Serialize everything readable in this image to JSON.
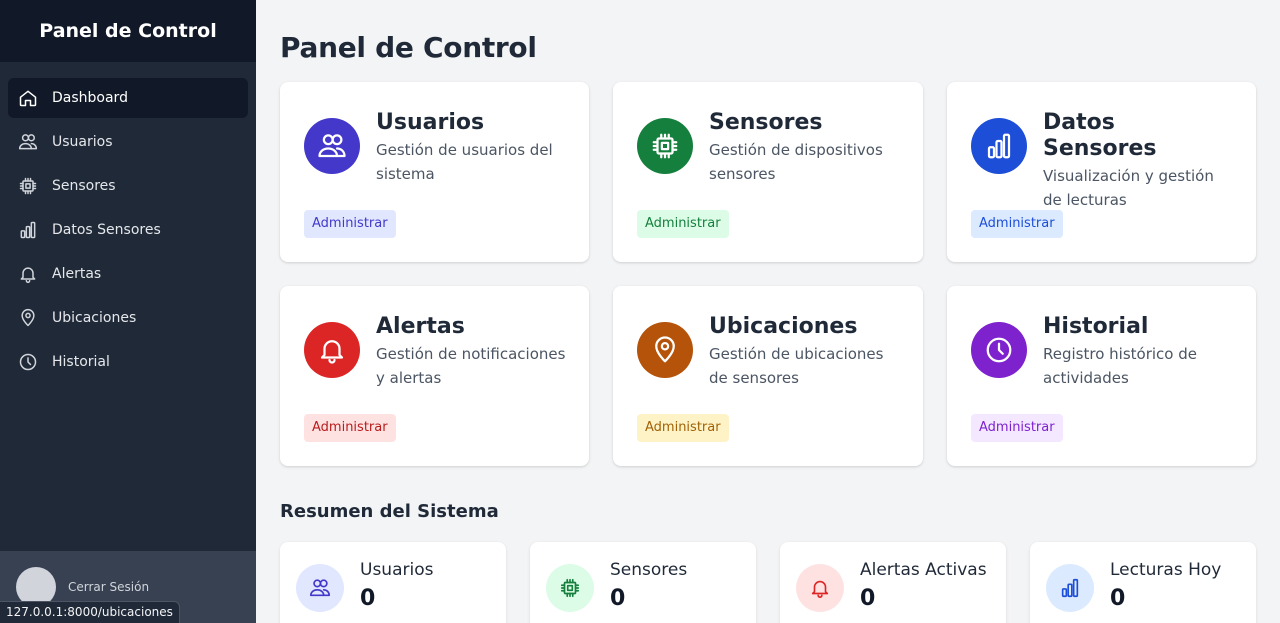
{
  "sidebar": {
    "title": "Panel de Control",
    "items": [
      {
        "label": "Dashboard",
        "icon": "home-icon"
      },
      {
        "label": "Usuarios",
        "icon": "users-icon"
      },
      {
        "label": "Sensores",
        "icon": "chip-icon"
      },
      {
        "label": "Datos Sensores",
        "icon": "bar-chart-icon"
      },
      {
        "label": "Alertas",
        "icon": "bell-icon"
      },
      {
        "label": "Ubicaciones",
        "icon": "map-pin-icon"
      },
      {
        "label": "Historial",
        "icon": "clock-icon"
      }
    ],
    "logout_label": "Cerrar Sesión"
  },
  "status_bar": {
    "url": "127.0.0.1:8000/ubicaciones"
  },
  "main": {
    "title": "Panel de Control",
    "cards": [
      {
        "title": "Usuarios",
        "description": "Gestión de usuarios del sistema",
        "action": "Administrar",
        "icon": "users-icon",
        "color": "#4338ca",
        "badge_bg": "#e0e7ff",
        "badge_fg": "#4338ca"
      },
      {
        "title": "Sensores",
        "description": "Gestión de dispositivos sensores",
        "action": "Administrar",
        "icon": "chip-icon",
        "color": "#15803d",
        "badge_bg": "#dcfce7",
        "badge_fg": "#15803d"
      },
      {
        "title": "Datos Sensores",
        "description": "Visualización y gestión de lecturas",
        "action": "Administrar",
        "icon": "bar-chart-icon",
        "color": "#1d4ed8",
        "badge_bg": "#dbeafe",
        "badge_fg": "#1d4ed8"
      },
      {
        "title": "Alertas",
        "description": "Gestión de notificaciones y alertas",
        "action": "Administrar",
        "icon": "bell-icon",
        "color": "#dc2626",
        "badge_bg": "#fee2e2",
        "badge_fg": "#b91c1c"
      },
      {
        "title": "Ubicaciones",
        "description": "Gestión de ubicaciones de sensores",
        "action": "Administrar",
        "icon": "map-pin-icon",
        "color": "#b45309",
        "badge_bg": "#fef3c7",
        "badge_fg": "#a16207"
      },
      {
        "title": "Historial",
        "description": "Registro histórico de actividades",
        "action": "Administrar",
        "icon": "clock-icon",
        "color": "#7e22ce",
        "badge_bg": "#f3e8ff",
        "badge_fg": "#7e22ce"
      }
    ],
    "summary_title": "Resumen del Sistema",
    "stats": [
      {
        "label": "Usuarios",
        "value": "0",
        "icon": "users-icon",
        "fg": "#4338ca",
        "bg": "#e0e7ff"
      },
      {
        "label": "Sensores",
        "value": "0",
        "icon": "chip-icon",
        "fg": "#15803d",
        "bg": "#dcfce7"
      },
      {
        "label": "Alertas Activas",
        "value": "0",
        "icon": "bell-icon",
        "fg": "#dc2626",
        "bg": "#fee2e2"
      },
      {
        "label": "Lecturas Hoy",
        "value": "0",
        "icon": "bar-chart-icon",
        "fg": "#1d4ed8",
        "bg": "#dbeafe"
      }
    ]
  }
}
